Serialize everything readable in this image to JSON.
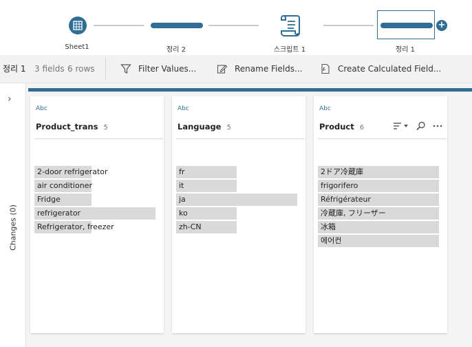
{
  "flow": {
    "nodes": [
      {
        "label": "Sheet1",
        "icon": "table-icon"
      },
      {
        "label": "정리 2",
        "icon": "clean-step-icon"
      },
      {
        "label": "스크립트 1",
        "icon": "script-icon"
      },
      {
        "label": "정리 1",
        "icon": "clean-step-icon",
        "selected": true
      }
    ],
    "add_icon": "+"
  },
  "toolbar": {
    "step_name": "정리 1",
    "fields": "3 fields",
    "rows": "6 rows",
    "filter_label": "Filter Values...",
    "rename_label": "Rename Fields...",
    "calc_label": "Create Calculated Field..."
  },
  "changes": {
    "chevron": "›",
    "label": "Changes (0)"
  },
  "colors": {
    "accent": "#2f6d94",
    "bar": "#d9d9d9",
    "profile_bg": "#f4f4f4"
  },
  "cards": [
    {
      "type": "Abc",
      "name": "Product_trans",
      "count": "5",
      "values": [
        {
          "text": "2-door refrigerator",
          "fraction": 0.47
        },
        {
          "text": "air conditioner",
          "fraction": 0.47
        },
        {
          "text": "Fridge",
          "fraction": 0.47
        },
        {
          "text": "refrigerator",
          "fraction": 1.0
        },
        {
          "text": "Refrigerator, freezer",
          "fraction": 0.47
        }
      ]
    },
    {
      "type": "Abc",
      "name": "Language",
      "count": "5",
      "values": [
        {
          "text": "fr",
          "fraction": 0.5
        },
        {
          "text": "it",
          "fraction": 0.5
        },
        {
          "text": "ja",
          "fraction": 1.0
        },
        {
          "text": "ko",
          "fraction": 0.5
        },
        {
          "text": "zh-CN",
          "fraction": 0.5
        }
      ]
    },
    {
      "type": "Abc",
      "name": "Product",
      "count": "6",
      "values": [
        {
          "text": "2ドア冷蔵庫",
          "fraction": 1.0
        },
        {
          "text": "frigorifero",
          "fraction": 1.0
        },
        {
          "text": "Réfrigérateur",
          "fraction": 1.0
        },
        {
          "text": "冷蔵庫, フリーザー",
          "fraction": 1.0
        },
        {
          "text": "冰箱",
          "fraction": 1.0
        },
        {
          "text": "에어컨",
          "fraction": 1.0
        }
      ]
    }
  ]
}
